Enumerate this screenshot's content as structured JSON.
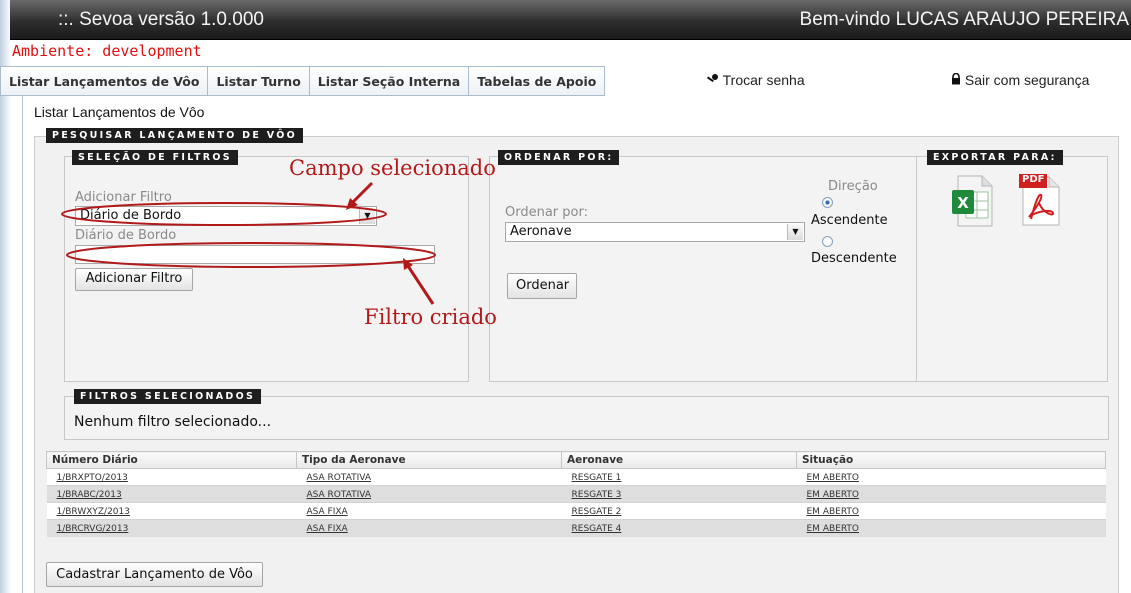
{
  "header": {
    "app_title": "::.  Sevoa versão 1.0.000",
    "welcome": "Bem-vindo LUCAS ARAUJO PEREIRA",
    "environment": "Ambiente: development"
  },
  "tabs": [
    {
      "label": "Listar Lançamentos de Vôo"
    },
    {
      "label": "Listar Turno"
    },
    {
      "label": "Listar Seção Interna"
    },
    {
      "label": "Tabelas de Apoio"
    }
  ],
  "user_links": {
    "change_password": "Trocar senha",
    "logout": "Sair com segurança",
    "change_password_icon": "key-icon",
    "logout_icon": "lock-icon"
  },
  "breadcrumb": "Listar Lançamentos de Vôo",
  "search": {
    "title": "PESQUISAR LANÇAMENTO DE VÔO",
    "filters": {
      "title": "SELEÇÃO DE FILTROS",
      "add_filter_label": "Adicionar Filtro",
      "add_filter_selected": "Diário de Bordo",
      "created_filter_label": "Diário de Bordo",
      "created_filter_value": "",
      "add_filter_button": "Adicionar Filtro"
    },
    "order": {
      "title": "ORDENAR POR:",
      "order_by_label": "Ordenar por:",
      "order_by_selected": "Aeronave",
      "direction_label": "Direção",
      "ascending": "Ascendente",
      "descending": "Descendente",
      "selected_direction": "Ascendente",
      "order_button": "Ordenar"
    },
    "export": {
      "title": "EXPORTAR PARA:",
      "excel_icon": "excel-icon",
      "pdf_icon": "pdf-icon",
      "pdf_badge": "PDF"
    },
    "selected_filters": {
      "title": "FILTROS SELECIONADOS",
      "empty_text": "Nenhum filtro selecionado..."
    }
  },
  "annotations": {
    "selected_field": "Campo selecionado",
    "created_filter": "Filtro criado"
  },
  "table": {
    "headers": [
      "Número Diário",
      "Tipo da Aeronave",
      "Aeronave",
      "Situação"
    ],
    "rows": [
      [
        "1/BRXPTO/2013",
        "ASA ROTATIVA",
        "RESGATE 1",
        "EM ABERTO"
      ],
      [
        "1/BRABC/2013",
        "ASA ROTATIVA",
        "RESGATE 3",
        "EM ABERTO"
      ],
      [
        "1/BRWXYZ/2013",
        "ASA FIXA",
        "RESGATE 2",
        "EM ABERTO"
      ],
      [
        "1/BRCRVG/2013",
        "ASA FIXA",
        "RESGATE 4",
        "EM ABERTO"
      ]
    ]
  },
  "create_button": "Cadastrar Lançamento de Vôo",
  "colors": {
    "environment_text": "#e01010",
    "annotation": "#b21a1a",
    "header_bg": "#2e2e2e",
    "section_label_bg": "#1e1e1e",
    "excel_green": "#1f8a3a",
    "pdf_red": "#d11f1f"
  }
}
